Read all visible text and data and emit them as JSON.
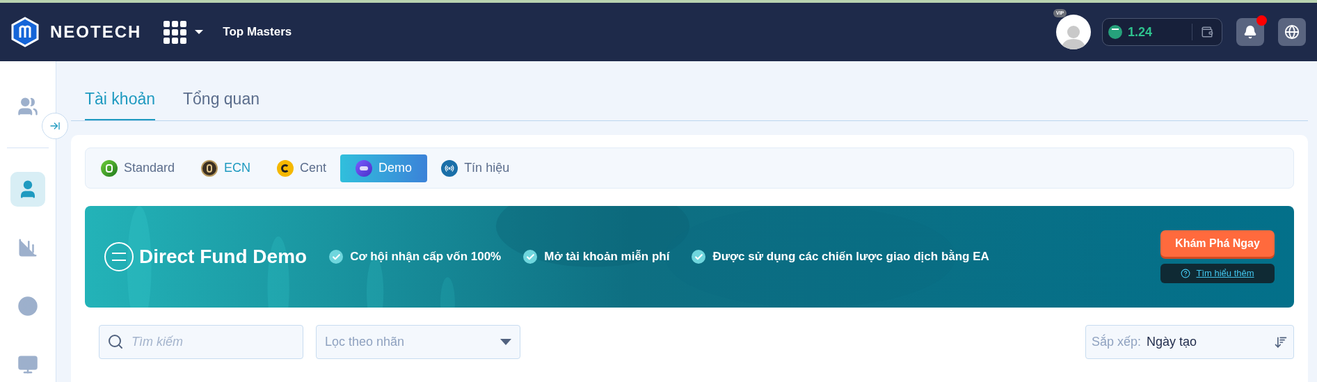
{
  "header": {
    "brand": "NEOTECH",
    "nav_link": "Top Masters",
    "avatar_badge": "VIP",
    "balance": "1.24",
    "notifications_unread": true
  },
  "sidebar": {
    "items": [
      {
        "selected": false
      },
      {
        "selected": true
      },
      {
        "selected": false
      },
      {
        "selected": false
      },
      {
        "selected": false
      }
    ]
  },
  "tabs": [
    {
      "label": "Tài khoản",
      "selected": true
    },
    {
      "label": "Tổng quan",
      "selected": false
    }
  ],
  "account_types": [
    {
      "label": "Standard",
      "kind": "standard",
      "selected": false
    },
    {
      "label": "ECN",
      "kind": "ecn",
      "selected": false
    },
    {
      "label": "Cent",
      "kind": "cent",
      "selected": false
    },
    {
      "label": "Demo",
      "kind": "demo",
      "selected": true
    },
    {
      "label": "Tín hiệu",
      "kind": "signal",
      "selected": false
    }
  ],
  "banner": {
    "title": "Direct Fund Demo",
    "features": [
      "Cơ hội nhận cấp vốn 100%",
      "Mở tài khoản miễn phí",
      "Được sử dụng các chiến lược giao dịch bằng EA"
    ],
    "cta": "Khám Phá Ngay",
    "learn_more": "Tìm hiểu thêm"
  },
  "filters": {
    "search_placeholder": "Tìm kiếm",
    "label_filter_placeholder": "Lọc theo nhãn",
    "sort_label": "Sắp xếp:",
    "sort_value": "Ngày tạo"
  }
}
